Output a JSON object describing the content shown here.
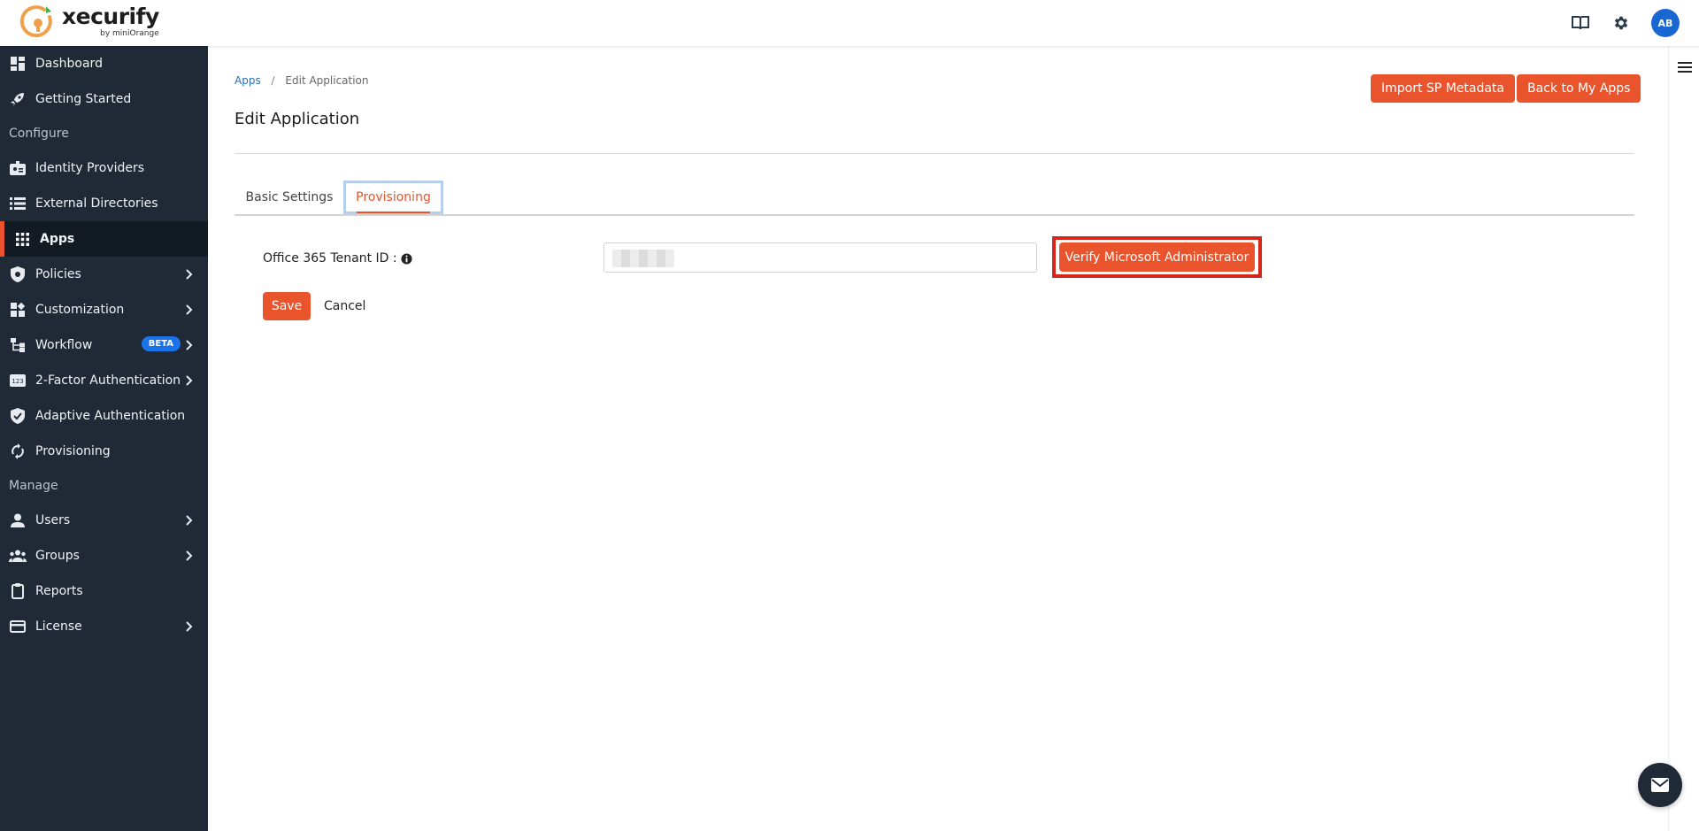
{
  "header": {
    "logo_name": "xecurify",
    "logo_by": "by miniOrange",
    "icons": [
      "book-icon",
      "gear-icon"
    ],
    "avatar_initials": "AB"
  },
  "sidebar": {
    "items": [
      {
        "label": "Dashboard",
        "icon": "dashboard-icon"
      },
      {
        "label": "Getting Started",
        "icon": "rocket-icon"
      },
      {
        "section": "Configure"
      },
      {
        "label": "Identity Providers",
        "icon": "badge-icon"
      },
      {
        "label": "External Directories",
        "icon": "list-icon"
      },
      {
        "label": "Apps",
        "icon": "apps-grid-icon",
        "active": true
      },
      {
        "label": "Policies",
        "icon": "shield-icon",
        "chevron": true
      },
      {
        "label": "Customization",
        "icon": "customize-icon",
        "chevron": true
      },
      {
        "label": "Workflow",
        "icon": "workflow-icon",
        "chevron": true,
        "badge": "BETA"
      },
      {
        "label": "2-Factor Authentication",
        "icon": "twofa-icon",
        "chevron": true
      },
      {
        "label": "Adaptive Authentication",
        "icon": "verified-shield-icon"
      },
      {
        "label": "Provisioning",
        "icon": "sync-icon"
      },
      {
        "section": "Manage"
      },
      {
        "label": "Users",
        "icon": "user-icon",
        "chevron": true
      },
      {
        "label": "Groups",
        "icon": "groups-icon",
        "chevron": true
      },
      {
        "label": "Reports",
        "icon": "clipboard-icon"
      },
      {
        "label": "License",
        "icon": "card-icon",
        "chevron": true
      }
    ]
  },
  "main": {
    "breadcrumb": {
      "link": "Apps",
      "separator": "/",
      "current": "Edit Application"
    },
    "title": "Edit Application",
    "import_button": "Import SP Metadata",
    "back_button": "Back to My Apps",
    "tabs": [
      {
        "label": "Basic Settings"
      },
      {
        "label": "Provisioning",
        "active": true
      }
    ],
    "form": {
      "tenant_label": "Office 365 Tenant ID :",
      "tenant_value": "",
      "verify_button": "Verify Microsoft Administrator",
      "save_button": "Save",
      "cancel_button": "Cancel"
    }
  },
  "colors": {
    "accent": "#e9542d",
    "sidebar_bg": "#1f2a36",
    "highlight_frame": "#d4271c",
    "avatar": "#1967d2",
    "beta_badge": "#1a73e8"
  }
}
